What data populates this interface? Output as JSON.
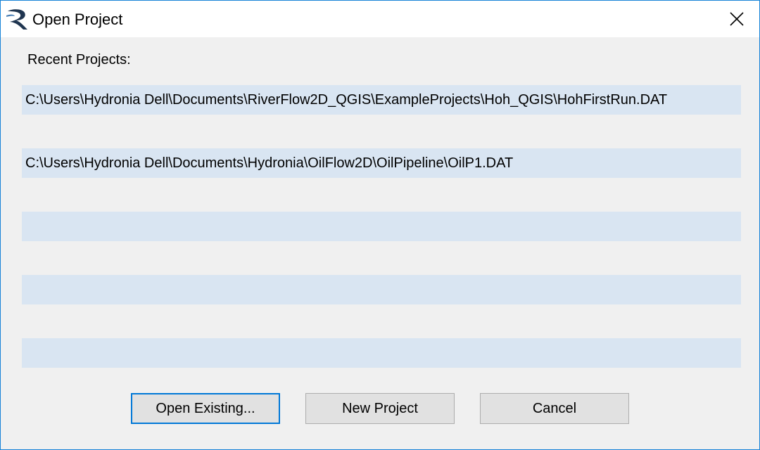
{
  "window": {
    "title": "Open Project",
    "app_icon": "riverflow-r-icon",
    "close_icon": "close-icon"
  },
  "recent": {
    "label": "Recent Projects:",
    "items": [
      "C:\\Users\\Hydronia Dell\\Documents\\RiverFlow2D_QGIS\\ExampleProjects\\Hoh_QGIS\\HohFirstRun.DAT",
      "C:\\Users\\Hydronia Dell\\Documents\\Hydronia\\OilFlow2D\\OilPipeline\\OilP1.DAT",
      "",
      "",
      ""
    ]
  },
  "buttons": {
    "open_existing": "Open Existing...",
    "new_project": "New Project",
    "cancel": "Cancel"
  },
  "colors": {
    "accent": "#0078d7",
    "window_border": "#1883d7",
    "list_item_bg": "#d9e5f2",
    "dialog_bg": "#f0f0f0",
    "button_bg": "#e1e1e1"
  }
}
